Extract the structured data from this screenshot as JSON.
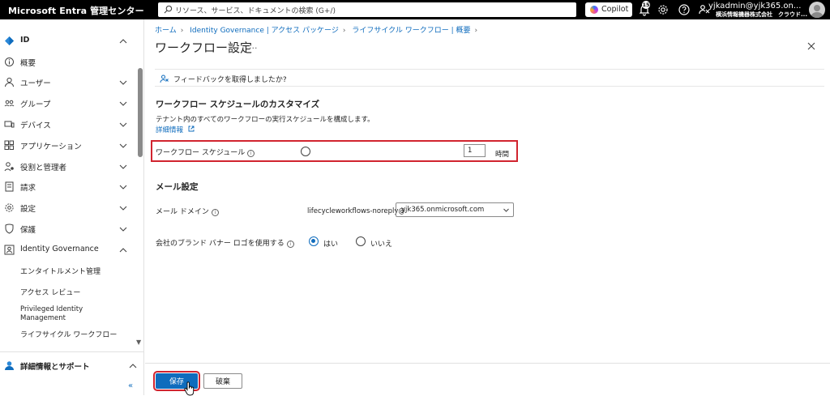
{
  "topbar": {
    "brand": "Microsoft Entra 管理センター",
    "search_placeholder": "リソース、サービス、ドキュメントの検索 (G+/)",
    "copilot_label": "Copilot",
    "notification_count": "15",
    "user_name": "yjkadmin@yjk365.on...",
    "user_org": "横浜情報機器株式会社　クラウド..."
  },
  "sidebar": {
    "items": [
      {
        "label": "ID",
        "icon": "diamond-icon"
      },
      {
        "label": "概要",
        "icon": "info-icon"
      },
      {
        "label": "ユーザー",
        "icon": "user-icon"
      },
      {
        "label": "グループ",
        "icon": "group-icon"
      },
      {
        "label": "デバイス",
        "icon": "devices-icon"
      },
      {
        "label": "アプリケーション",
        "icon": "apps-icon"
      },
      {
        "label": "役割と管理者",
        "icon": "roles-icon"
      },
      {
        "label": "請求",
        "icon": "billing-icon"
      },
      {
        "label": "設定",
        "icon": "settings-icon"
      },
      {
        "label": "保護",
        "icon": "protection-icon"
      },
      {
        "label": "Identity Governance",
        "icon": "governance-icon"
      }
    ],
    "sub_items": [
      "エンタイトルメント管理",
      "アクセス レビュー",
      "Privileged Identity",
      "Management",
      "ライフサイクル ワークフロー"
    ],
    "bottom_item": "詳細情報とサポート",
    "collapse_glyph": "«"
  },
  "main": {
    "breadcrumbs": [
      "ホーム",
      "Identity Governance | アクセス パッケージ",
      "ライフサイクル ワークフロー | 概要"
    ],
    "title": "ワークフロー設定",
    "more_glyph": "...",
    "feedback": "フィードバックを取得しましたか?",
    "schedule_section": {
      "title": "ワークフロー スケジュールのカスタマイズ",
      "description": "テナント内のすべてのワークフローの実行スケジュールを構成します。",
      "link": "詳細情報",
      "field_label": "ワークフロー スケジュール",
      "value": "1",
      "unit": "時間"
    },
    "mail_section": {
      "title": "メール設定",
      "domain_label": "メール ドメイン",
      "prefix": "lifecycleworkflows-noreply@",
      "domain_value": "yjk365.onmicrosoft.com",
      "brand_label": "会社のブランド バナー ロゴを使用する",
      "yes": "はい",
      "no": "いいえ",
      "selected": "はい"
    },
    "save_label": "保存",
    "discard_label": "破棄"
  }
}
